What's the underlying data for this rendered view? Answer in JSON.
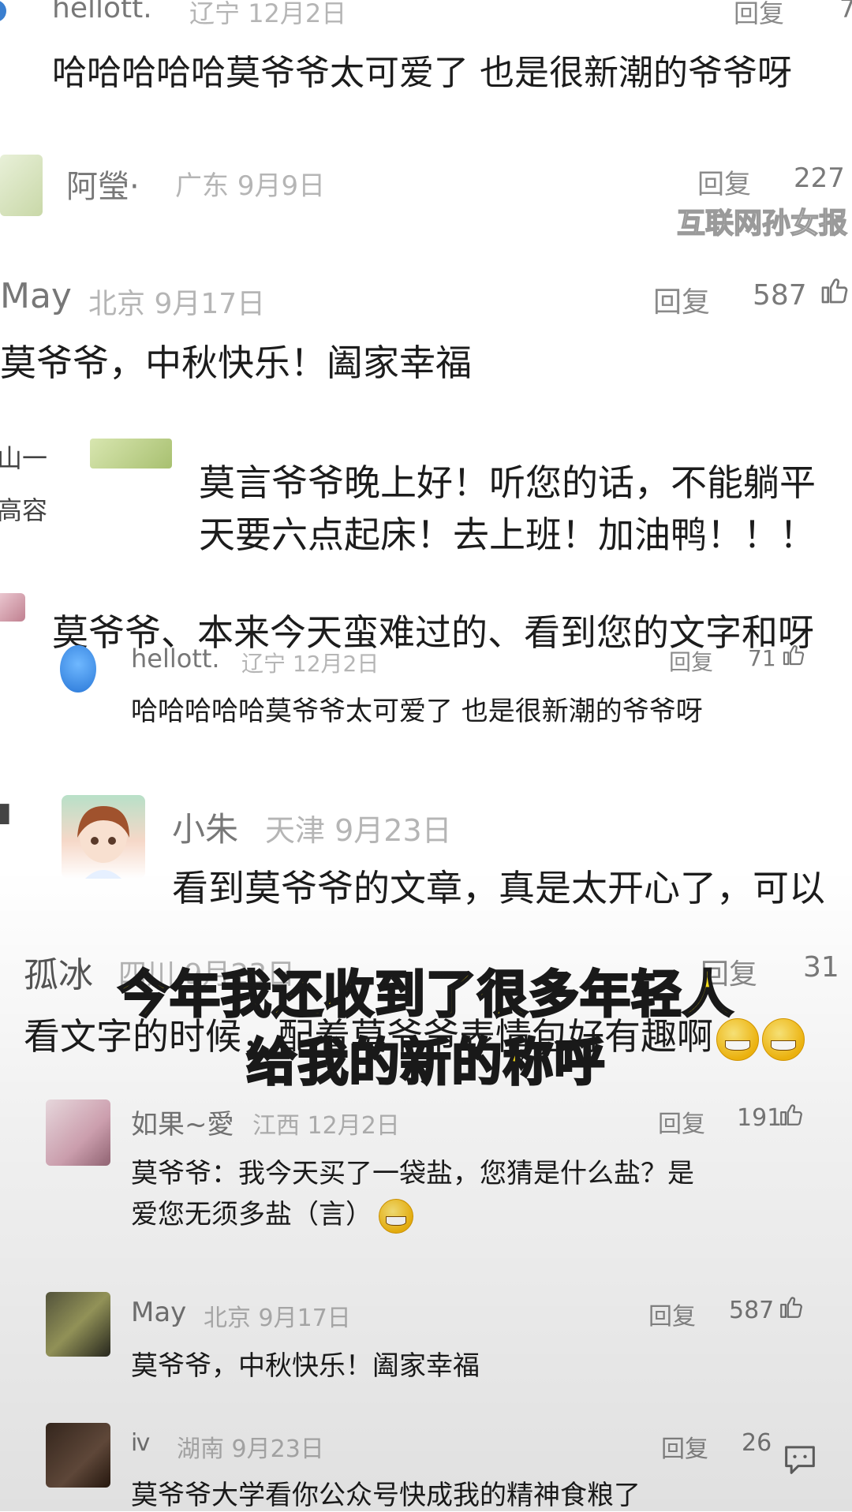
{
  "watermark": "互联网孙女报",
  "caption": [
    "今年我还收到了很多年轻人",
    "给我的新的称呼"
  ],
  "reply_label": "回复",
  "comments": [
    {
      "name": "hellott.",
      "location": "辽宁",
      "date": "12月2日",
      "reply": "回复",
      "likes": "7",
      "text": "哈哈哈哈哈莫爷爷太可爱了 也是很新潮的爷爷呀"
    },
    {
      "name": "阿瑩·",
      "location": "广东",
      "date": "9月9日",
      "reply": "回复",
      "likes": "227",
      "text": ""
    },
    {
      "name": "May",
      "location": "北京",
      "date": "9月17日",
      "reply": "回复",
      "likes": "587",
      "text": "莫爷爷，中秋快乐！阖家幸福"
    },
    {
      "name": "",
      "location": "",
      "date": "",
      "reply": "",
      "likes": "",
      "text_lines": [
        "莫言爷爷晚上好！听您的话，不能躺平",
        "天要六点起床！去上班！加油鸭！！！"
      ],
      "side_chars": [
        "山一",
        "高容"
      ]
    },
    {
      "name": "",
      "location": "",
      "date": "",
      "reply": "",
      "likes": "",
      "text": "莫爷爷、本来今天蛮难过的、看到您的文字和呀"
    },
    {
      "name": "hellott.",
      "location": "辽宁",
      "date": "12月2日",
      "reply": "回复",
      "likes": "71",
      "text": "哈哈哈哈哈莫爷爷太可爱了 也是很新潮的爷爷呀"
    },
    {
      "name": "小朱",
      "location": "天津",
      "date": "9月23日",
      "reply": "",
      "likes": "",
      "text": "看到莫爷爷的文章，真是太开心了，可以"
    },
    {
      "name": "孤冰",
      "location": "四川",
      "date": "9月23日",
      "reply": "回复",
      "likes": "31",
      "text": "看文字的时候，配着莫爷爷表情包好有趣啊"
    },
    {
      "name": "如果~愛",
      "location": "江西",
      "date": "12月2日",
      "reply": "回复",
      "likes": "191",
      "text_lines": [
        "莫爷爷：我今天买了一袋盐，您猜是什么盐？是",
        "爱您无须多盐（言）"
      ]
    },
    {
      "name": "May",
      "location": "北京",
      "date": "9月17日",
      "reply": "回复",
      "likes": "587",
      "text": "莫爷爷，中秋快乐！阖家幸福"
    },
    {
      "name": "ⅳ",
      "location": "湖南",
      "date": "9月23日",
      "reply": "回复",
      "likes": "26",
      "text": "莫爷爷大学看你公众号快成我的精神食粮了"
    }
  ],
  "colors": {
    "caption": "#ffe51a",
    "caption_stroke": "#1a1a1a",
    "meta": "#b5b5b5"
  },
  "icons": [
    "thumb-up-icon",
    "chat-bubble-icon",
    "emoji-grin-icon",
    "emoji-smile-icon"
  ]
}
